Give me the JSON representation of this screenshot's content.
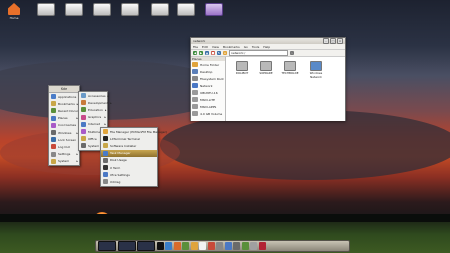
{
  "desktop": {
    "icons": [
      {
        "label": "Home",
        "icon": "home-icon"
      },
      {
        "label": "",
        "icon": "drive-icon"
      },
      {
        "label": "",
        "icon": "drive-icon"
      },
      {
        "label": "",
        "icon": "drive-icon"
      },
      {
        "label": "",
        "icon": "drive-icon"
      },
      {
        "label": "",
        "icon": "drive-icon"
      },
      {
        "label": "",
        "icon": "drive-icon"
      },
      {
        "label": "",
        "icon": "monitor-icon",
        "selected": true
      }
    ],
    "watermark": ""
  },
  "file_manager": {
    "title": "network",
    "menu": [
      "File",
      "Edit",
      "View",
      "Bookmarks",
      "Go",
      "Tools",
      "Help"
    ],
    "location": "network:/",
    "sidebar_header": "Places",
    "sidebar": [
      {
        "label": "Home Folder",
        "color": "#e0a43c"
      },
      {
        "label": "Desktop",
        "color": "#5b7fb8"
      },
      {
        "label": "Filesystem Root",
        "color": "#888888"
      },
      {
        "label": "Network",
        "color": "#4a78c4"
      },
      {
        "label": "UBUNTU-16",
        "color": "#999999"
      },
      {
        "label": "MSDI-LITE",
        "color": "#999999"
      },
      {
        "label": "MSDI-APPS",
        "color": "#999999"
      },
      {
        "label": "4.0 GB Volume",
        "color": "#999999"
      }
    ],
    "files": [
      "DOLIBOT",
      "SOPRADE",
      "TECHBOLDE",
      "Windows Network"
    ]
  },
  "app_menu": {
    "header": "Kde",
    "items": [
      {
        "label": "Applications",
        "color": "#4a7cc8",
        "sub": true
      },
      {
        "label": "Bookmarks",
        "color": "#c8a648",
        "sub": true
      },
      {
        "label": "Recent Documents",
        "color": "#5a8f3a",
        "sub": true
      },
      {
        "label": "Places",
        "color": "#4a78c4",
        "sub": true
      },
      {
        "label": "Cool Games",
        "color": "#a85ac8",
        "sub": true
      },
      {
        "label": "Windows",
        "color": "#6a6a6a",
        "sub": true
      },
      {
        "label": "Lock Screen",
        "color": "#3a6ea8",
        "sub": false
      },
      {
        "label": "Log Out",
        "color": "#c84a3a",
        "sub": false
      },
      {
        "label": "Settings",
        "color": "#888888",
        "sub": true
      },
      {
        "label": "System",
        "color": "#c8a648",
        "sub": true
      }
    ]
  },
  "sub_menu_1": {
    "items": [
      {
        "label": "Accessories",
        "color": "#6a9ac8",
        "sub": true
      },
      {
        "label": "Development",
        "color": "#c87a3a",
        "sub": true
      },
      {
        "label": "Education",
        "color": "#5a8f3a",
        "sub": true
      },
      {
        "label": "Graphics",
        "color": "#c84a8a",
        "sub": true
      },
      {
        "label": "Internet",
        "color": "#4a78c4",
        "sub": true
      },
      {
        "label": "Multimedia",
        "color": "#a85ac8",
        "sub": true
      },
      {
        "label": "Office",
        "color": "#c8a648",
        "sub": true
      },
      {
        "label": "System",
        "color": "#6a6a6a",
        "sub": true
      }
    ]
  },
  "sub_menu_2": {
    "items": [
      {
        "label": "File Manager (PCManFM File Manager)",
        "color": "#e0a43c"
      },
      {
        "label": "LXTerminal Terminal",
        "color": "#222222"
      },
      {
        "label": "Software Installer",
        "color": "#c8a648"
      },
      {
        "label": "Task Manager",
        "color": "#4a7cc8",
        "highlight": true
      },
      {
        "label": "Disk Usage",
        "color": "#6a6a6a"
      },
      {
        "label": "X Term",
        "color": "#333333"
      },
      {
        "label": "Xfce Settings",
        "color": "#4a78c4"
      },
      {
        "label": "Xdmsg",
        "color": "#888888"
      }
    ]
  },
  "dock": {
    "launchers": [
      {
        "icon": "window-thumbnail-icon",
        "color": "#2a3147"
      },
      {
        "icon": "window-thumbnail-icon",
        "color": "#2a3147"
      },
      {
        "icon": "window-thumbnail-icon",
        "color": "#2a3147"
      },
      {
        "icon": "terminal-icon",
        "color": "#111111"
      },
      {
        "icon": "network-icon",
        "color": "#3a7ec8"
      },
      {
        "icon": "browser-icon",
        "color": "#d86a2a"
      },
      {
        "icon": "mail-icon",
        "color": "#5a8f3a"
      },
      {
        "icon": "folder-icon",
        "color": "#e0a43c"
      },
      {
        "icon": "document-icon",
        "color": "#f2f2f2"
      },
      {
        "icon": "media-icon",
        "color": "#c84a3a"
      },
      {
        "icon": "disk-icon",
        "color": "#888888"
      },
      {
        "icon": "monitor-icon",
        "color": "#4a78c4"
      },
      {
        "icon": "volume-icon",
        "color": "#6a6a6a"
      },
      {
        "icon": "battery-icon",
        "color": "#5a8f3a"
      },
      {
        "icon": "settings-icon",
        "color": "#a0a0a0"
      },
      {
        "icon": "flag-icon",
        "color": "#b22234"
      }
    ],
    "clock": ""
  }
}
